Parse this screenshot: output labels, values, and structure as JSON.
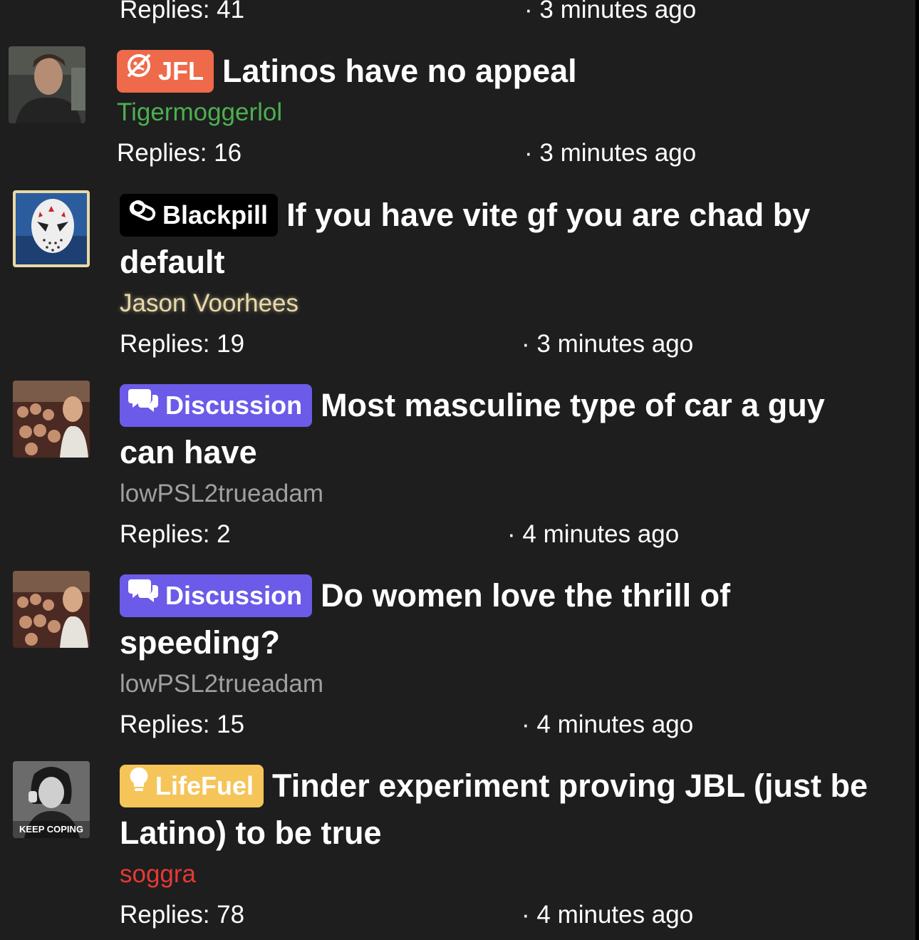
{
  "partial_thread": {
    "replies": "Replies: 41",
    "time": "· 3 minutes ago"
  },
  "threads": [
    {
      "tag": "JFL",
      "title": "Latinos have no appeal",
      "author": "Tigermoggerlol",
      "author_color": "#4caf50",
      "replies": "Replies: 16",
      "time": "· 3 minutes ago"
    },
    {
      "tag": "Blackpill",
      "title": "If you have vite gf you are chad by default",
      "author": "Jason Voorhees",
      "author_color": "#e8d9a8",
      "replies": "Replies: 19",
      "time": "· 3 minutes ago"
    },
    {
      "tag": "Discussion",
      "title": "Most masculine type of car a guy can have",
      "author": "lowPSL2trueadam",
      "author_color": "#a0a0a0",
      "replies": "Replies: 2",
      "time": "· 4 minutes ago"
    },
    {
      "tag": "Discussion",
      "title": "Do women love the thrill of speeding?",
      "author": "lowPSL2trueadam",
      "author_color": "#a0a0a0",
      "replies": "Replies: 15",
      "time": "· 4 minutes ago"
    },
    {
      "tag": "LifeFuel",
      "title": "Tinder experiment proving JBL (just be Latino) to be true",
      "author": "soggra",
      "author_color": "#e53935",
      "replies": "Replies: 78",
      "time": "· 4 minutes ago",
      "avatar_caption": "KEEP COPING"
    }
  ]
}
